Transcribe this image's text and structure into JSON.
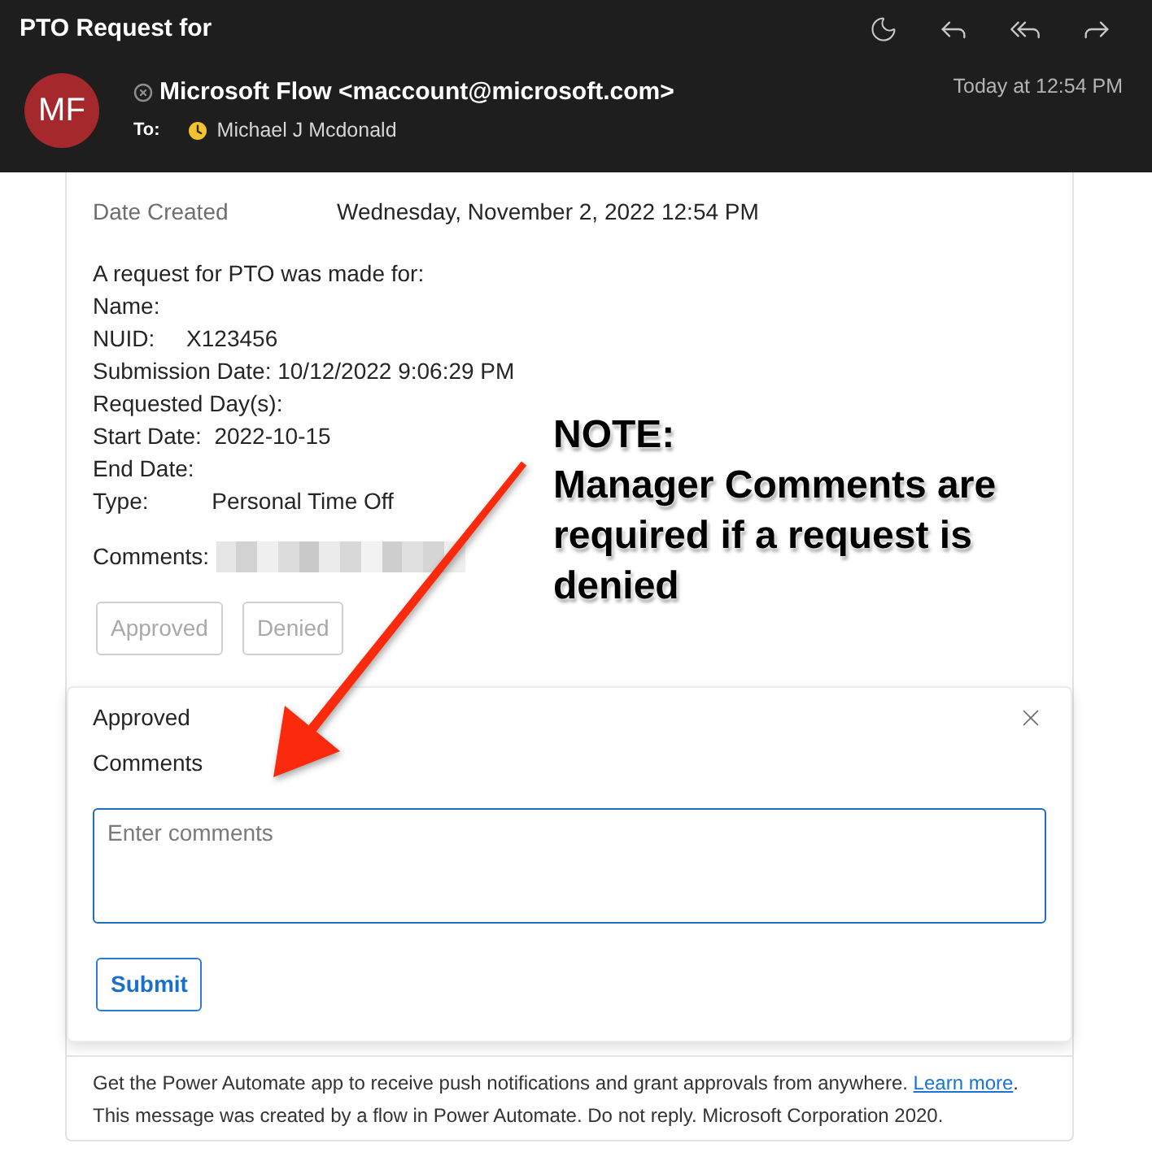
{
  "window": {
    "title": "PTO Request for"
  },
  "message": {
    "avatar_initials": "MF",
    "sender": "Microsoft Flow <maccount@microsoft.com>",
    "to_label": "To:",
    "recipient": "Michael J Mcdonald",
    "received": "Today at 12:54 PM"
  },
  "approval": {
    "date_label": "Date Created",
    "date_value": "Wednesday, November 2, 2022 12:54 PM",
    "lines": [
      "A request for PTO was made for:",
      "Name:",
      "NUID:     X123456",
      "Submission Date: 10/12/2022 9:06:29 PM",
      "Requested Day(s):",
      "Start Date:  2022-10-15",
      "End Date:",
      "Type:          Personal Time Off"
    ],
    "comments_label": "Comments:",
    "actions": [
      {
        "label": "Approved",
        "disabled": true
      },
      {
        "label": "Denied",
        "disabled": true
      }
    ]
  },
  "response_panel": {
    "title": "Approved",
    "comments_label": "Comments",
    "comments_field": {
      "placeholder": "Enter comments"
    },
    "submit": {
      "label": "Submit"
    }
  },
  "footer": {
    "text_before": "Get the Power Automate app to receive push notifications and grant approvals from anywhere.",
    "link": "Learn more",
    "text_after": ". This message was created by a flow in Power Automate. Do not reply. Microsoft Corporation 2020."
  },
  "annotation": {
    "title": "NOTE:",
    "text": "Manager Comments are required if a request is denied"
  }
}
